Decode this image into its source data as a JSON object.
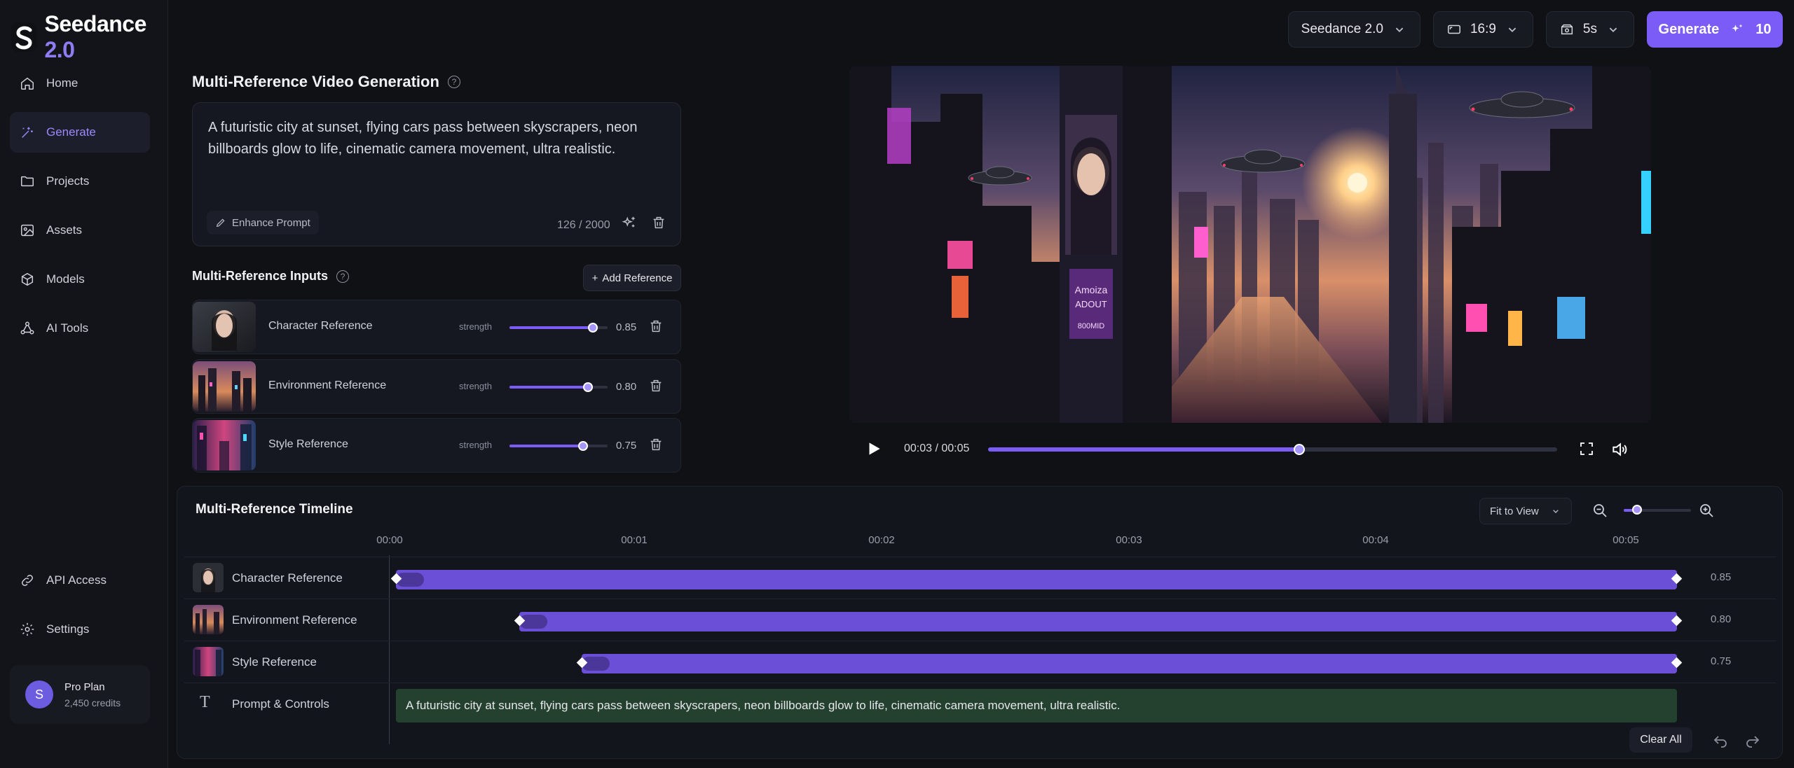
{
  "app": {
    "name": "Seedance",
    "version": "2.0"
  },
  "sidebar": {
    "items": [
      {
        "label": "Home",
        "icon": "home-icon",
        "active": false
      },
      {
        "label": "Generate",
        "icon": "generate-icon",
        "active": true
      },
      {
        "label": "Projects",
        "icon": "folder-icon",
        "active": false
      },
      {
        "label": "Assets",
        "icon": "image-icon",
        "active": false
      },
      {
        "label": "Models",
        "icon": "cube-icon",
        "active": false
      },
      {
        "label": "AI Tools",
        "icon": "tools-icon",
        "active": false
      }
    ],
    "bottom_items": [
      {
        "label": "API Access",
        "icon": "link-icon"
      },
      {
        "label": "Settings",
        "icon": "gear-icon"
      }
    ],
    "plan": {
      "avatar_letter": "S",
      "title": "Pro Plan",
      "credits": "2,450 credits"
    }
  },
  "topbar": {
    "model": "Seedance 2.0",
    "aspect": "16:9",
    "duration": "5s",
    "generate_label": "Generate",
    "generate_cost": "10"
  },
  "prompt_section": {
    "title": "Multi-Reference Video Generation",
    "text": "A futuristic city at sunset, flying cars pass between skyscrapers, neon billboards glow to life, cinematic camera movement, ultra realistic.",
    "enhance_label": "Enhance Prompt",
    "counter": "126 / 2000"
  },
  "references": {
    "title": "Multi-Reference Inputs",
    "add_label": "Add Reference",
    "strength_label": "strength",
    "items": [
      {
        "label": "Character Reference",
        "strength": 0.85,
        "strength_text": "0.85"
      },
      {
        "label": "Environment Reference",
        "strength": 0.8,
        "strength_text": "0.80"
      },
      {
        "label": "Style Reference",
        "strength": 0.75,
        "strength_text": "0.75"
      }
    ]
  },
  "video": {
    "billboard_text_1": "Amoiza",
    "billboard_text_2": "ADOUT",
    "billboard_text_3": "800MID",
    "timecode": "00:03 / 00:05",
    "progress": 0.545
  },
  "timeline": {
    "title": "Multi-Reference Timeline",
    "fit_label": "Fit to View",
    "zoom": 0.2,
    "ticks": [
      "00:00",
      "00:01",
      "00:02",
      "00:03",
      "00:04",
      "00:05"
    ],
    "rows": [
      {
        "label": "Character Reference",
        "value": "0.85",
        "start": 0.0
      },
      {
        "label": "Environment Reference",
        "value": "0.80",
        "start": 0.5
      },
      {
        "label": "Style Reference",
        "value": "0.75",
        "start": 0.75
      }
    ],
    "prompt_row_label": "Prompt & Controls",
    "prompt_text": "A futuristic city at sunset, flying cars pass between skyscrapers, neon billboards glow to life, cinematic camera movement, ultra realistic.",
    "clear_label": "Clear All"
  },
  "colors": {
    "accent": "#7c5cf6",
    "accent_light": "#9a88ff",
    "bg": "#0f1115"
  }
}
